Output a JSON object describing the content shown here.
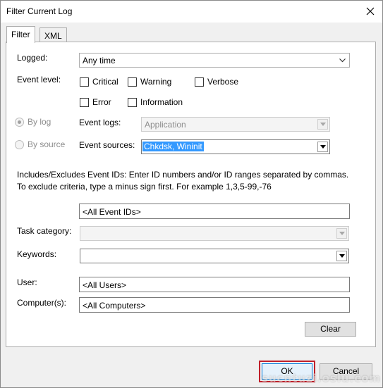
{
  "window": {
    "title": "Filter Current Log"
  },
  "tabs": [
    {
      "label": "Filter"
    },
    {
      "label": "XML"
    }
  ],
  "filter": {
    "logged_label": "Logged:",
    "logged_value": "Any time",
    "event_level_label": "Event level:",
    "levels": {
      "critical": "Critical",
      "warning": "Warning",
      "verbose": "Verbose",
      "error": "Error",
      "information": "Information"
    },
    "by_log_label": "By log",
    "by_source_label": "By source",
    "event_logs_label": "Event logs:",
    "event_logs_value": "Application",
    "event_sources_label": "Event sources:",
    "event_sources_value": "Chkdsk, Wininit",
    "description": "Includes/Excludes Event IDs: Enter ID numbers and/or ID ranges separated by commas. To exclude criteria, type a minus sign first. For example 1,3,5-99,-76",
    "event_ids_value": "<All Event IDs>",
    "task_category_label": "Task category:",
    "keywords_label": "Keywords:",
    "user_label": "User:",
    "user_value": "<All Users>",
    "computer_label": "Computer(s):",
    "computer_value": "<All Computers>",
    "clear_label": "Clear"
  },
  "footer": {
    "ok_label": "OK",
    "cancel_label": "Cancel"
  },
  "watermark": "sucntuzi.oslu.com",
  "colors": {
    "selection": "#3399ff",
    "highlight_border": "#c0202a",
    "ok_focus": "#0078d7"
  }
}
